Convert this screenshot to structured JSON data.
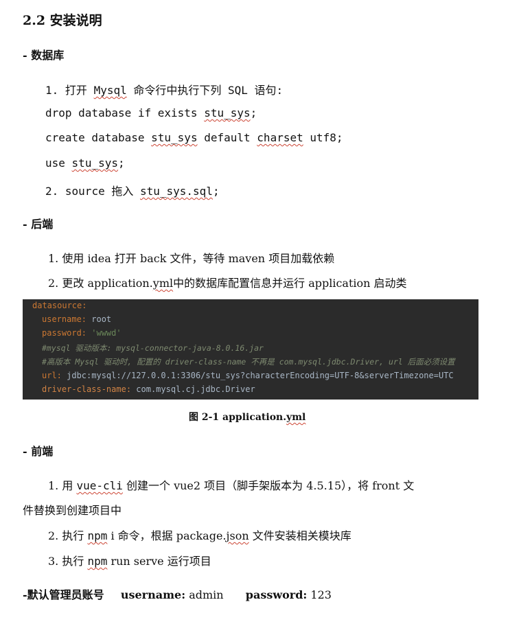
{
  "title": "2.2 安装说明",
  "db": {
    "heading": "- 数据库",
    "step1_num": "1.",
    "step1_pre": "打开",
    "step1_mysql": "Mysql",
    "step1_post": "命令行中执行下列 SQL 语句:",
    "sql1_pre": "drop database if exists",
    "sql1_name": "stu_sys",
    "sql1_post": ";",
    "sql2_pre": "create database",
    "sql2_name": "stu_sys",
    "sql2_mid": "default",
    "sql2_charset": "charset",
    "sql2_post": "utf8;",
    "sql3_pre": "use",
    "sql3_name": "stu_sys",
    "sql3_post": ";",
    "step2_num": "2.",
    "step2_pre": "source 拖入",
    "step2_file": "stu_sys.sql",
    "step2_post": ";"
  },
  "backend": {
    "heading": "- 后端",
    "step1": "1. 使用 idea 打开 back 文件，等待 maven 项目加载依赖",
    "step2_pre": "2. 更改 application.",
    "step2_yml": "yml",
    "step2_post": "中的数据库配置信息并运行 application 启动类"
  },
  "code": {
    "l1_key": "datasource:",
    "l2_key": "username:",
    "l2_val": " root",
    "l3_key": "password:",
    "l3_val": " 'wwwd'",
    "l4": "#mysql 驱动版本: mysql-connector-java-8.0.16.jar",
    "l5": "#高版本 Mysql 驱动时, 配置的 driver-class-name 不再是 com.mysql.jdbc.Driver, url 后面必须设置",
    "l6_key": "url:",
    "l6_val": " jdbc:mysql://127.0.0.1:3306/stu_sys?characterEncoding=UTF-8&serverTimezone=UTC",
    "l7_key": "driver-class-name:",
    "l7_val": " com.mysql.cj.jdbc.Driver"
  },
  "caption_pre": "图 2-1 application.",
  "caption_yml": "yml",
  "frontend": {
    "heading": "- 前端",
    "step1_pre": "1. 用",
    "step1_cli": "vue-cli",
    "step1_post": "创建一个 vue2 项目（脚手架版本为 4.5.15），将 front 文",
    "step1_cont": "件替换到创建项目中",
    "step2_pre": "2. 执行",
    "step2_npm": "npm",
    "step2_mid": "i 命令，根据 package.",
    "step2_json": "json",
    "step2_post": "文件安装相关模块库",
    "step3_pre": "3. 执行",
    "step3_npm": "npm",
    "step3_post": "run serve 运行项目"
  },
  "admin": {
    "label": "-默认管理员账号",
    "user_key": "username:",
    "user_val": "admin",
    "pass_key": "password:",
    "pass_val": "123"
  }
}
